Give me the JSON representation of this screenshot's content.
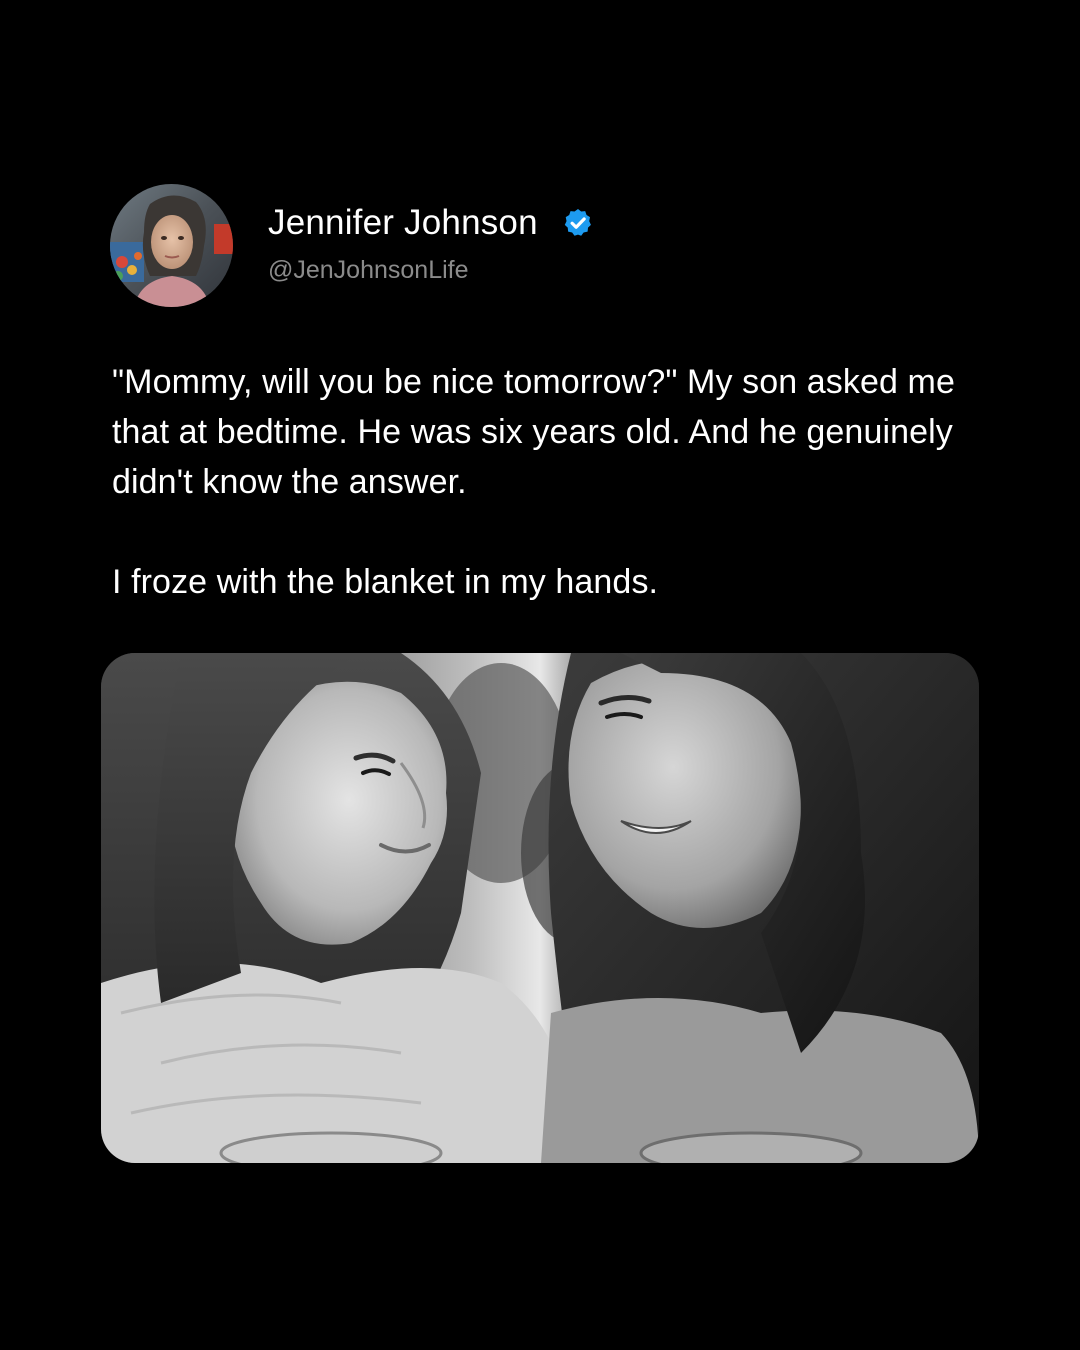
{
  "author": {
    "display_name": "Jennifer Johnson",
    "handle": "@JenJohnsonLife",
    "verified": true,
    "verified_icon": "verified-badge-icon",
    "verified_color": "#1d9bf0"
  },
  "post": {
    "paragraphs": [
      "\"Mommy, will you be nice tomorrow?\" My son asked me that at bedtime. He was six years old. And he genuinely didn't know the answer.",
      "I froze with the blanket in my hands."
    ]
  },
  "colors": {
    "background": "#000000",
    "text": "#ffffff",
    "handle": "#8b8b8b"
  }
}
